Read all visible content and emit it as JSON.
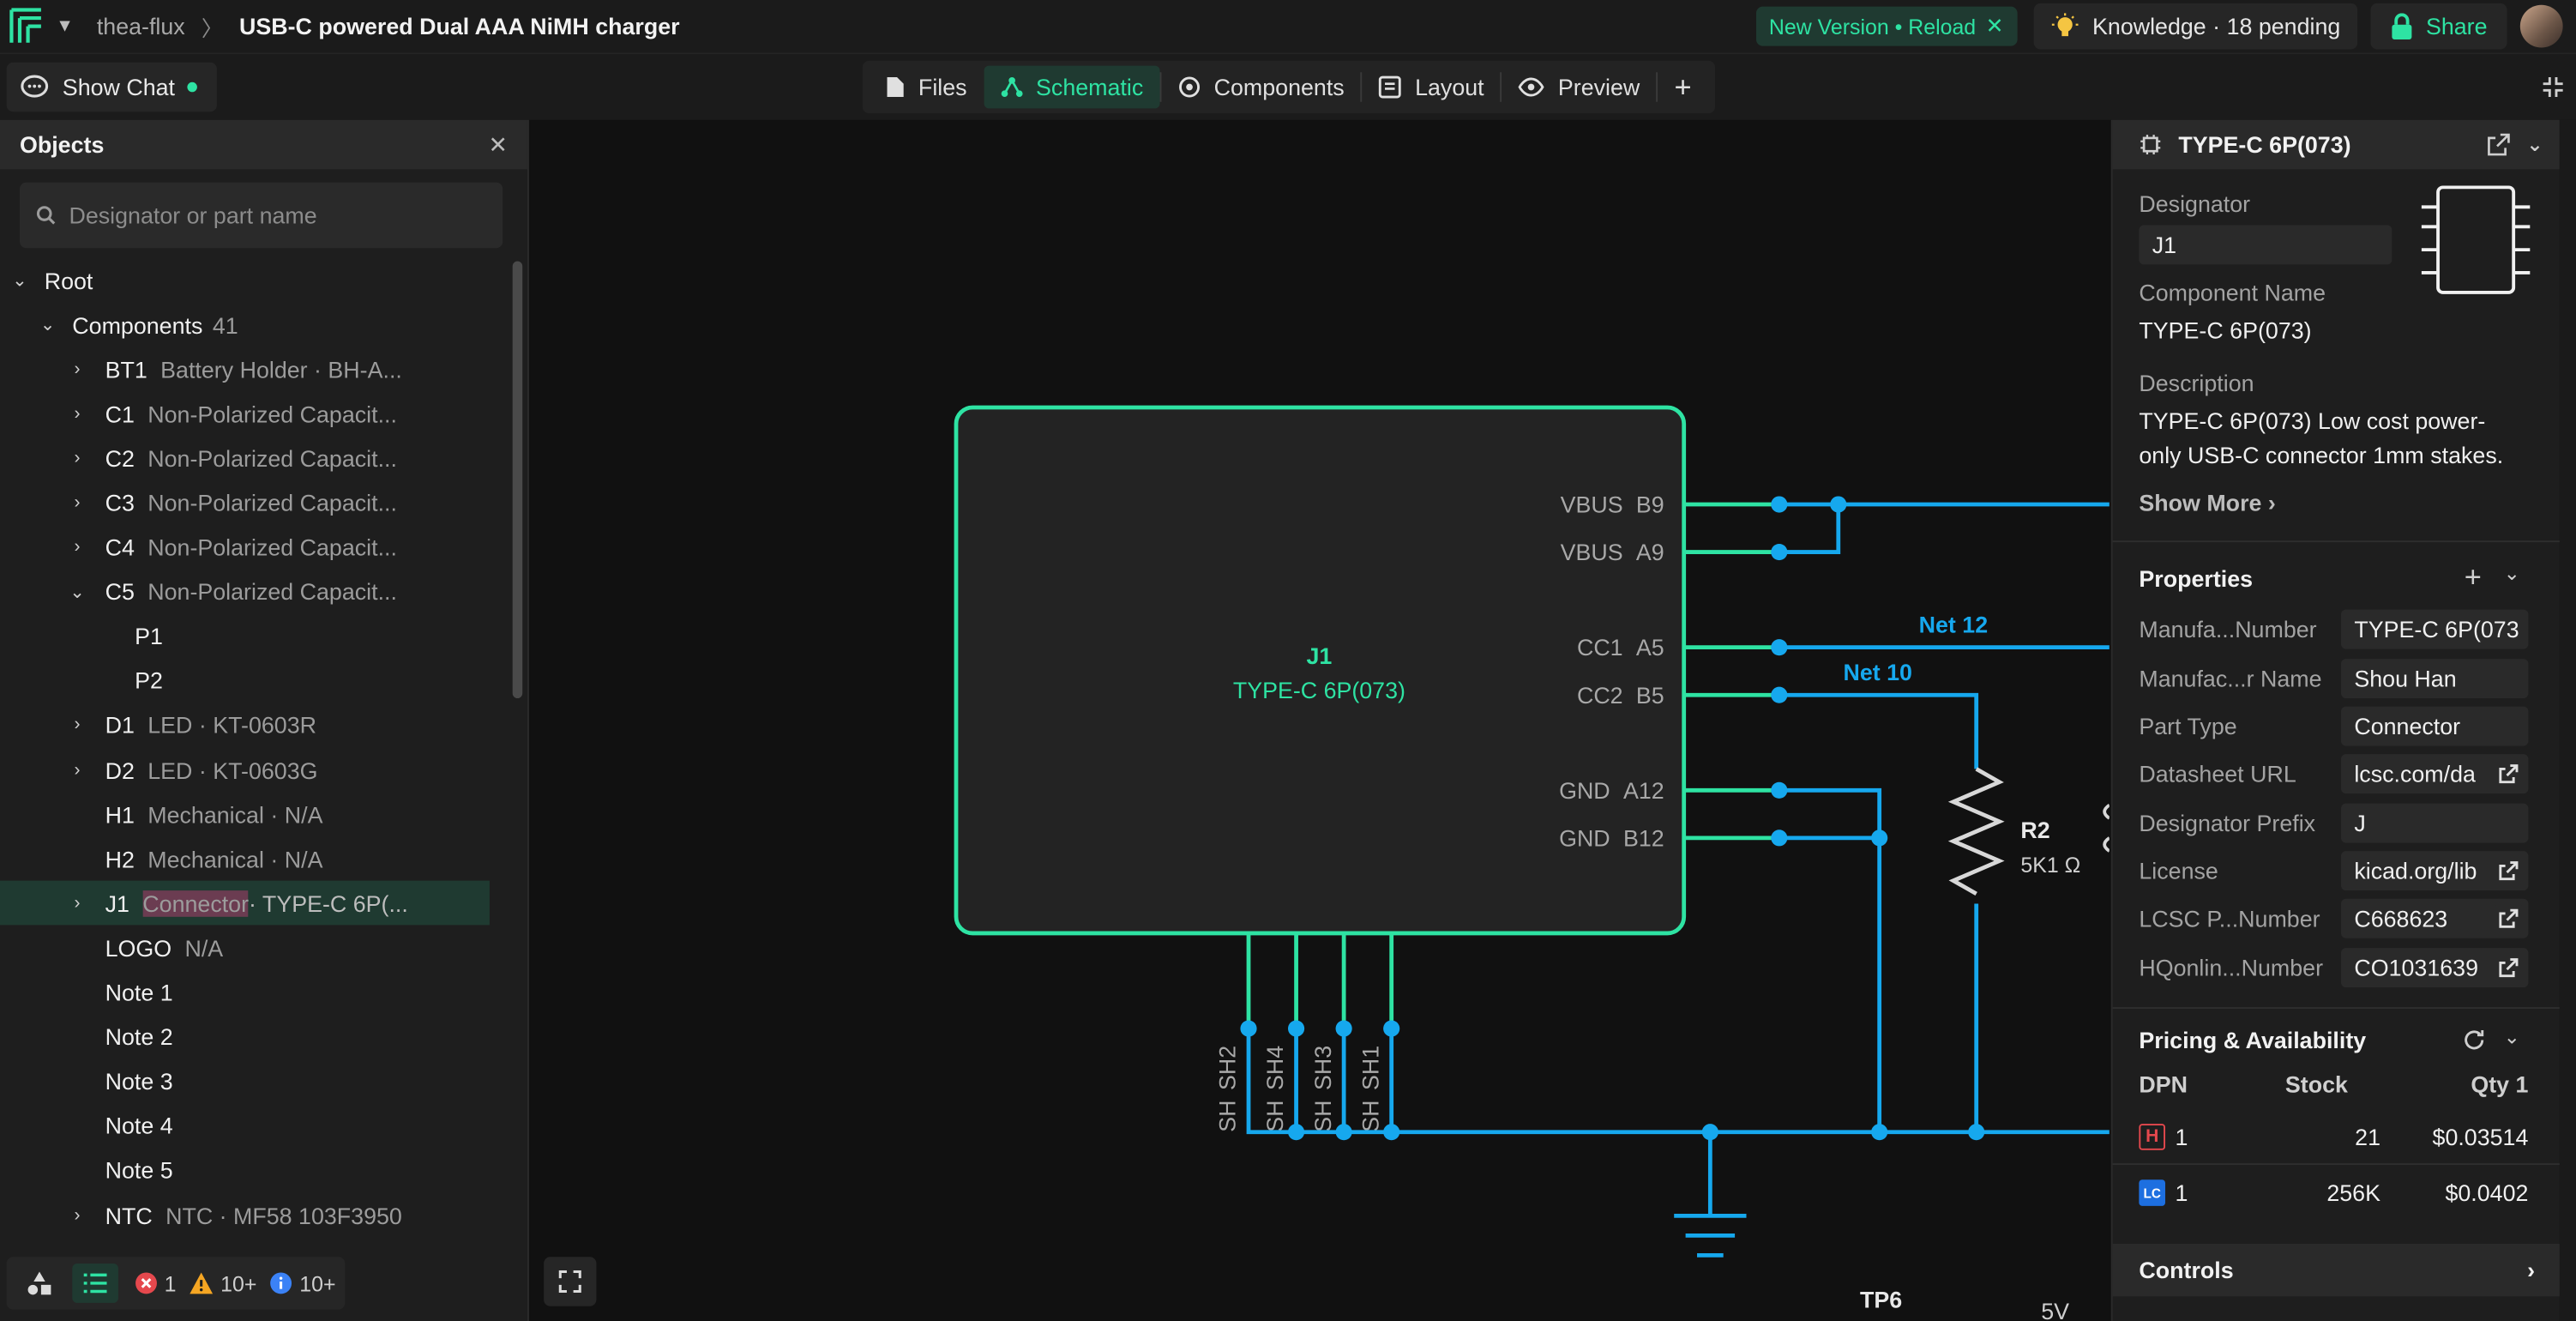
{
  "topbar": {
    "org": "thea-flux",
    "project_title": "USB-C powered Dual AAA NiMH charger",
    "reload_label": "New Version • Reload",
    "knowledge_label": "Knowledge · 18 pending",
    "share_label": "Share"
  },
  "subbar": {
    "show_chat": "Show Chat",
    "tabs": [
      {
        "label": "Files",
        "icon": "file-icon"
      },
      {
        "label": "Schematic",
        "icon": "schematic-icon",
        "active": true
      },
      {
        "label": "Components",
        "icon": "components-icon"
      },
      {
        "label": "Layout",
        "icon": "layout-icon"
      },
      {
        "label": "Preview",
        "icon": "eye-icon"
      }
    ]
  },
  "objects": {
    "title": "Objects",
    "search_placeholder": "Designator or part name",
    "root": "Root",
    "components_label": "Components",
    "components_count": "41",
    "items": [
      {
        "des": "BT1",
        "meta": "Battery Holder · BH-A..."
      },
      {
        "des": "C1",
        "meta": "Non-Polarized Capacit..."
      },
      {
        "des": "C2",
        "meta": "Non-Polarized Capacit..."
      },
      {
        "des": "C3",
        "meta": "Non-Polarized Capacit..."
      },
      {
        "des": "C4",
        "meta": "Non-Polarized Capacit..."
      },
      {
        "des": "C5",
        "meta": "Non-Polarized Capacit..."
      },
      {
        "des": "P1",
        "meta": ""
      },
      {
        "des": "P2",
        "meta": ""
      },
      {
        "des": "D1",
        "meta": "LED · KT-0603R"
      },
      {
        "des": "D2",
        "meta": "LED · KT-0603G"
      },
      {
        "des": "H1",
        "meta": "Mechanical · N/A"
      },
      {
        "des": "H2",
        "meta": "Mechanical · N/A"
      },
      {
        "des": "J1",
        "meta_hl": "Connector",
        "meta": " · TYPE-C 6P(..."
      },
      {
        "des": "LOGO",
        "meta": "N/A"
      },
      {
        "des": "Note 1",
        "meta": ""
      },
      {
        "des": "Note 2",
        "meta": ""
      },
      {
        "des": "Note 3",
        "meta": ""
      },
      {
        "des": "Note 4",
        "meta": ""
      },
      {
        "des": "Note 5",
        "meta": ""
      },
      {
        "des": "NTC",
        "meta": "NTC · MF58 103F3950"
      }
    ],
    "status": {
      "errors": "1",
      "warnings": "10+",
      "infos": "10+"
    }
  },
  "schematic": {
    "designator": "J1",
    "part": "TYPE-C 6P(073)",
    "pins_right": [
      {
        "name": "VBUS",
        "num": "B9"
      },
      {
        "name": "VBUS",
        "num": "A9"
      },
      {
        "name": "CC1",
        "num": "A5"
      },
      {
        "name": "CC2",
        "num": "B5"
      },
      {
        "name": "GND",
        "num": "A12"
      },
      {
        "name": "GND",
        "num": "B12"
      }
    ],
    "pins_bottom": [
      {
        "name": "SH",
        "num": "SH2"
      },
      {
        "name": "SH",
        "num": "SH4"
      },
      {
        "name": "SH",
        "num": "SH3"
      },
      {
        "name": "SH",
        "num": "SH1"
      }
    ],
    "nets": [
      "Net 12",
      "Net 10"
    ],
    "resistor": {
      "designator": "R2",
      "value": "5K1 Ω"
    },
    "labels": [
      "TP6",
      "5V"
    ],
    "colors": {
      "wire": "#16a8ee",
      "pin": "#2ee3a3",
      "body": "#2ee3a3"
    }
  },
  "inspector": {
    "title": "TYPE-C 6P(073)",
    "designator_label": "Designator",
    "designator": "J1",
    "component_name_label": "Component Name",
    "component_name": "TYPE-C 6P(073)",
    "description_label": "Description",
    "description_line1": "TYPE-C 6P(073) Low cost power-",
    "description_line2": "only USB-C connector 1mm stakes.",
    "show_more": "Show More",
    "properties_title": "Properties",
    "properties": [
      {
        "label": "Manufa...Number",
        "value": "TYPE-C 6P(073"
      },
      {
        "label": "Manufac...r Name",
        "value": "Shou Han"
      },
      {
        "label": "Part Type",
        "value": "Connector"
      },
      {
        "label": "Datasheet URL",
        "value": "lcsc.com/da"
      },
      {
        "label": "Designator Prefix",
        "value": "J"
      },
      {
        "label": "License",
        "value": "kicad.org/lib"
      },
      {
        "label": "LCSC P...Number",
        "value": "C668623"
      },
      {
        "label": "HQonlin...Number",
        "value": "CO1031639"
      }
    ],
    "pricing_title": "Pricing & Availability",
    "pricing_headers": {
      "dpn": "DPN",
      "stock": "Stock",
      "qty": "Qty 1"
    },
    "pricing_rows": [
      {
        "badge": "H",
        "dpn": "1",
        "stock": "21",
        "price": "$0.03514"
      },
      {
        "badge": "LC",
        "dpn": "1",
        "stock": "256K",
        "price": "$0.0402"
      }
    ],
    "controls_title": "Controls"
  }
}
